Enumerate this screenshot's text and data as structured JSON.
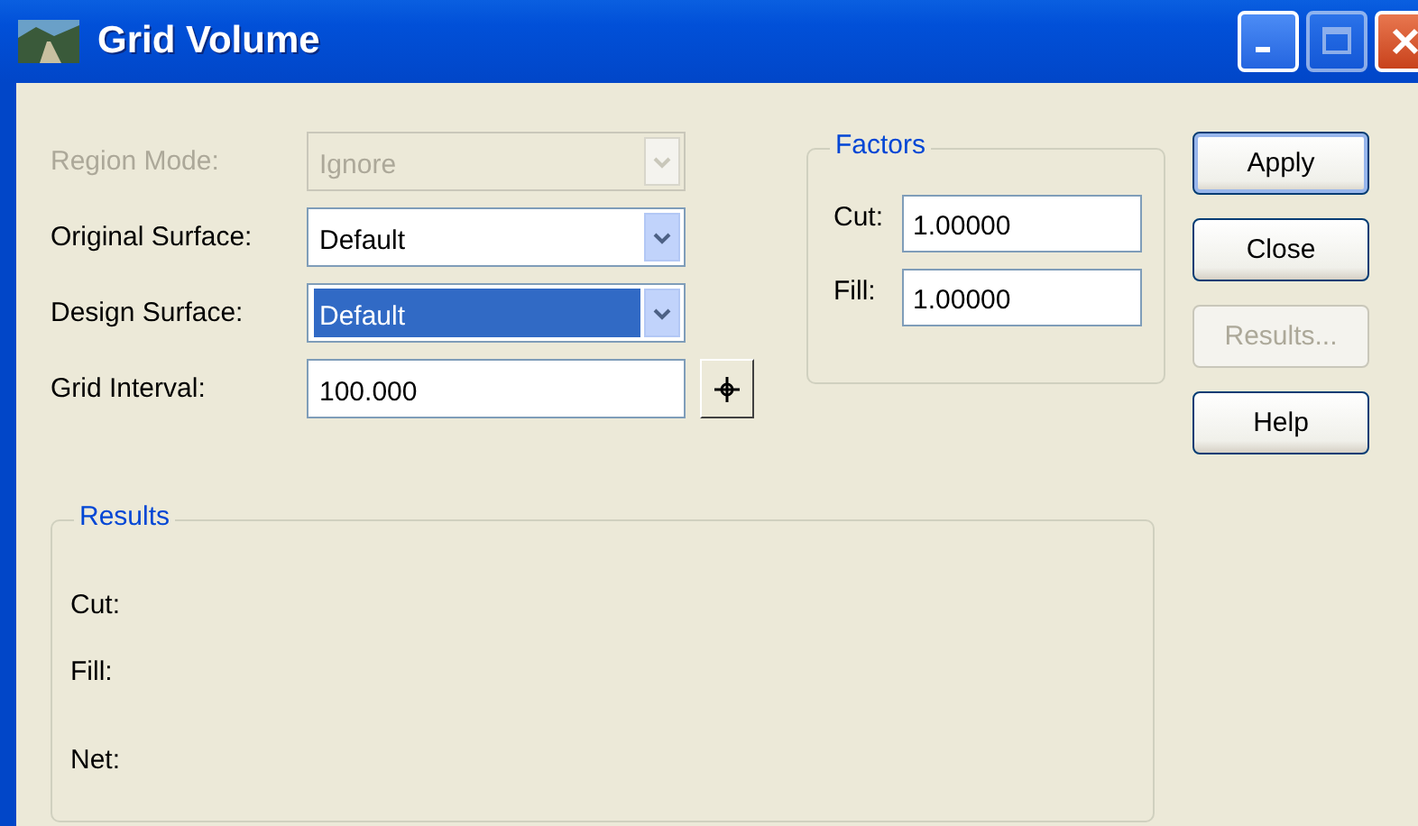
{
  "window": {
    "title": "Grid Volume"
  },
  "fields": [
    {
      "kind": "combo",
      "label": "Region Mode:",
      "value": "Ignore",
      "disabled": true,
      "highlighted": false
    },
    {
      "kind": "combo",
      "label": "Original Surface:",
      "value": "Default",
      "disabled": false,
      "highlighted": false
    },
    {
      "kind": "combo",
      "label": "Design Surface:",
      "value": "Default",
      "disabled": false,
      "highlighted": true
    },
    {
      "kind": "text",
      "label": "Grid Interval:",
      "value": "100.000",
      "disabled": false
    }
  ],
  "factors": {
    "title": "Factors",
    "fields": [
      {
        "label": "Cut:",
        "value": "1.00000"
      },
      {
        "label": "Fill:",
        "value": "1.00000"
      }
    ]
  },
  "buttons": [
    {
      "label": "Apply",
      "default": true,
      "disabled": false
    },
    {
      "label": "Close",
      "default": false,
      "disabled": false
    },
    {
      "label": "Results...",
      "default": false,
      "disabled": true
    },
    {
      "label": "Help",
      "default": false,
      "disabled": false
    }
  ],
  "results": {
    "title": "Results",
    "rows": [
      {
        "label": "Cut:"
      },
      {
        "label": "Fill:"
      },
      {
        "label": "Net:"
      }
    ]
  }
}
